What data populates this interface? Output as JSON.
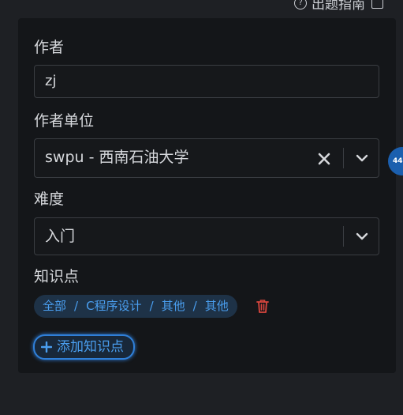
{
  "header": {
    "guide_link": "出题指南"
  },
  "form": {
    "author": {
      "label": "作者",
      "value": "zj"
    },
    "affiliation": {
      "label": "作者单位",
      "value": "swpu - 西南石油大学"
    },
    "difficulty": {
      "label": "难度",
      "value": "入门"
    },
    "knowledge": {
      "label": "知识点",
      "tag": {
        "parts": [
          "全部",
          "C程序设计",
          "其他",
          "其他"
        ],
        "separator": "/"
      },
      "add_button": "添加知识点"
    }
  },
  "side_badge": "44",
  "colors": {
    "background": "#1e2024",
    "panel": "#141619",
    "accent": "#4a9eef",
    "danger": "#d9463e"
  },
  "icons": {
    "help": "help-icon",
    "external": "external-link-icon",
    "clear": "close-icon",
    "dropdown": "chevron-down-icon",
    "delete": "trash-icon",
    "add": "plus-icon"
  }
}
